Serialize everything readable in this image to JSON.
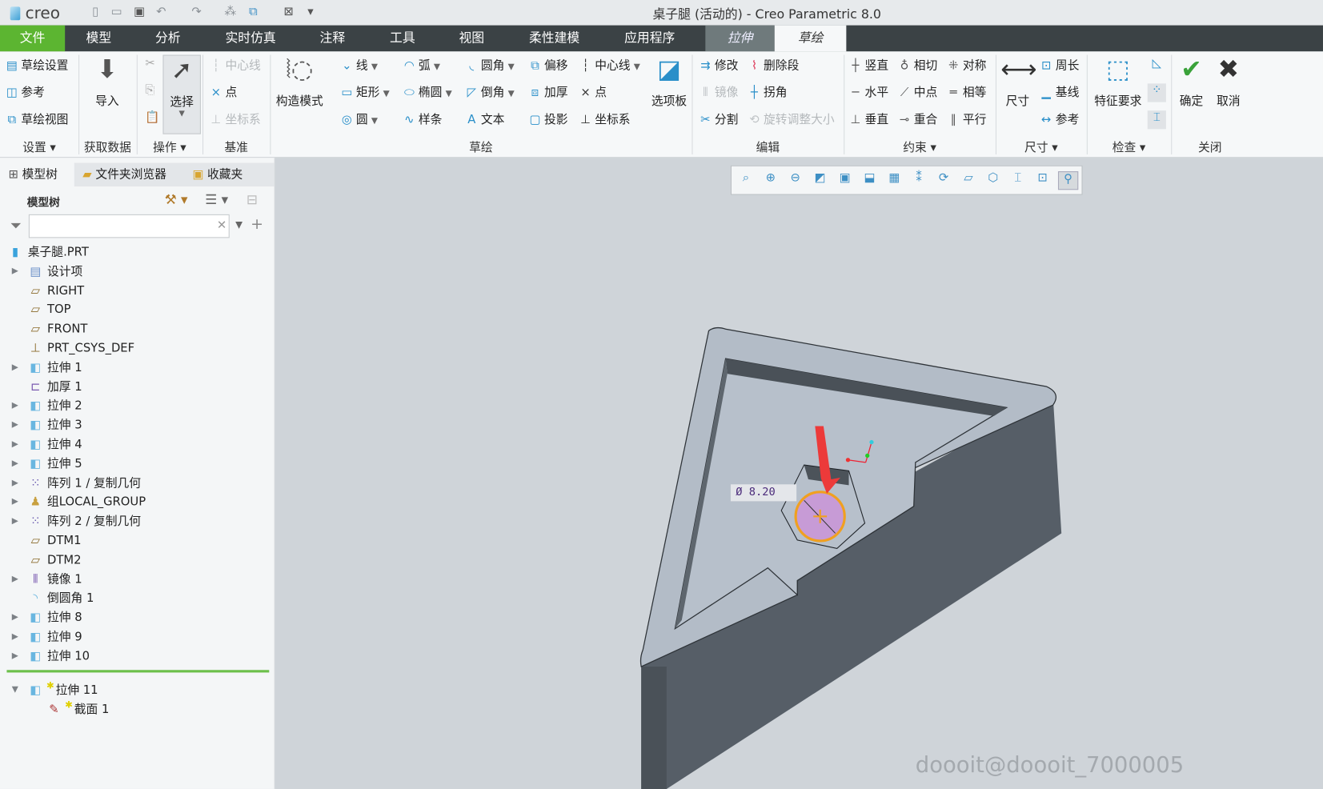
{
  "window": {
    "app_logo": "creo",
    "title": "桌子腿 (活动的) - Creo Parametric 8.0"
  },
  "menu": {
    "tabs": [
      "文件",
      "模型",
      "分析",
      "实时仿真",
      "注释",
      "工具",
      "视图",
      "柔性建模",
      "应用程序",
      "拉伸",
      "草绘"
    ],
    "active": "草绘"
  },
  "ribbon": {
    "groups": [
      "设置",
      "获取数据",
      "操作",
      "基准",
      "草绘",
      "编辑",
      "约束",
      "尺寸",
      "检查",
      "关闭"
    ],
    "setup": [
      "草绘设置",
      "参考",
      "草绘视图"
    ],
    "getdata": "导入",
    "operations": {
      "select": "选择"
    },
    "datum": [
      "中心线",
      "点",
      "坐标系"
    ],
    "sketch": {
      "construction": "构造模式",
      "col1": [
        "线",
        "矩形",
        "圆"
      ],
      "col2": [
        "弧",
        "椭圆",
        "样条"
      ],
      "col3": [
        "圆角",
        "倒角",
        "文本"
      ],
      "col4": [
        "偏移",
        "加厚",
        "投影"
      ],
      "col5": [
        "中心线",
        "点",
        "坐标系"
      ],
      "palette": "选项板"
    },
    "edit": {
      "col1": [
        "修改",
        "镜像",
        "分割"
      ],
      "col2": [
        "删除段",
        "拐角",
        "旋转调整大小"
      ]
    },
    "constrain": {
      "col1": [
        "竖直",
        "水平",
        "垂直"
      ],
      "col2": [
        "相切",
        "中点",
        "重合"
      ],
      "col3": [
        "对称",
        "相等",
        "平行"
      ]
    },
    "dimension": {
      "big": "尺寸",
      "items": [
        "周长",
        "基线",
        "参考"
      ]
    },
    "inspect": {
      "big": "特征要求"
    },
    "close": {
      "ok": "确定",
      "cancel": "取消"
    }
  },
  "panel": {
    "tabs": [
      "模型树",
      "文件夹浏览器",
      "收藏夹"
    ],
    "header": "模型树",
    "filter_placeholder": "",
    "tree": [
      {
        "label": "桌子腿.PRT",
        "icon": "part",
        "exp": ""
      },
      {
        "label": "设计项",
        "icon": "design",
        "exp": "▶"
      },
      {
        "label": "RIGHT",
        "icon": "plane",
        "exp": ""
      },
      {
        "label": "TOP",
        "icon": "plane",
        "exp": ""
      },
      {
        "label": "FRONT",
        "icon": "plane",
        "exp": ""
      },
      {
        "label": "PRT_CSYS_DEF",
        "icon": "csys",
        "exp": ""
      },
      {
        "label": "拉伸 1",
        "icon": "extrude",
        "exp": "▶"
      },
      {
        "label": "加厚 1",
        "icon": "thicken",
        "exp": ""
      },
      {
        "label": "拉伸 2",
        "icon": "extrude",
        "exp": "▶"
      },
      {
        "label": "拉伸 3",
        "icon": "extrude",
        "exp": "▶"
      },
      {
        "label": "拉伸 4",
        "icon": "extrude",
        "exp": "▶"
      },
      {
        "label": "拉伸 5",
        "icon": "extrude",
        "exp": "▶"
      },
      {
        "label": "阵列 1 / 复制几何",
        "icon": "pattern",
        "exp": "▶"
      },
      {
        "label": "组LOCAL_GROUP",
        "icon": "group",
        "exp": "▶"
      },
      {
        "label": "阵列 2 / 复制几何",
        "icon": "pattern",
        "exp": "▶"
      },
      {
        "label": "DTM1",
        "icon": "plane",
        "exp": ""
      },
      {
        "label": "DTM2",
        "icon": "plane",
        "exp": ""
      },
      {
        "label": "镜像 1",
        "icon": "mirror",
        "exp": "▶"
      },
      {
        "label": "倒圆角 1",
        "icon": "round",
        "exp": ""
      },
      {
        "label": "拉伸 8",
        "icon": "extrude",
        "exp": "▶"
      },
      {
        "label": "拉伸 9",
        "icon": "extrude",
        "exp": "▶"
      },
      {
        "label": "拉伸 10",
        "icon": "extrude",
        "exp": "▶"
      }
    ],
    "active": [
      {
        "label": "拉伸 11",
        "icon": "extrude",
        "exp": "▼"
      },
      {
        "label": "截面 1",
        "icon": "section",
        "exp": ""
      }
    ]
  },
  "viewport": {
    "dimension": "Ø  8.20",
    "watermark": "doooit@doooit_7000005",
    "accent": "#f0a020"
  }
}
